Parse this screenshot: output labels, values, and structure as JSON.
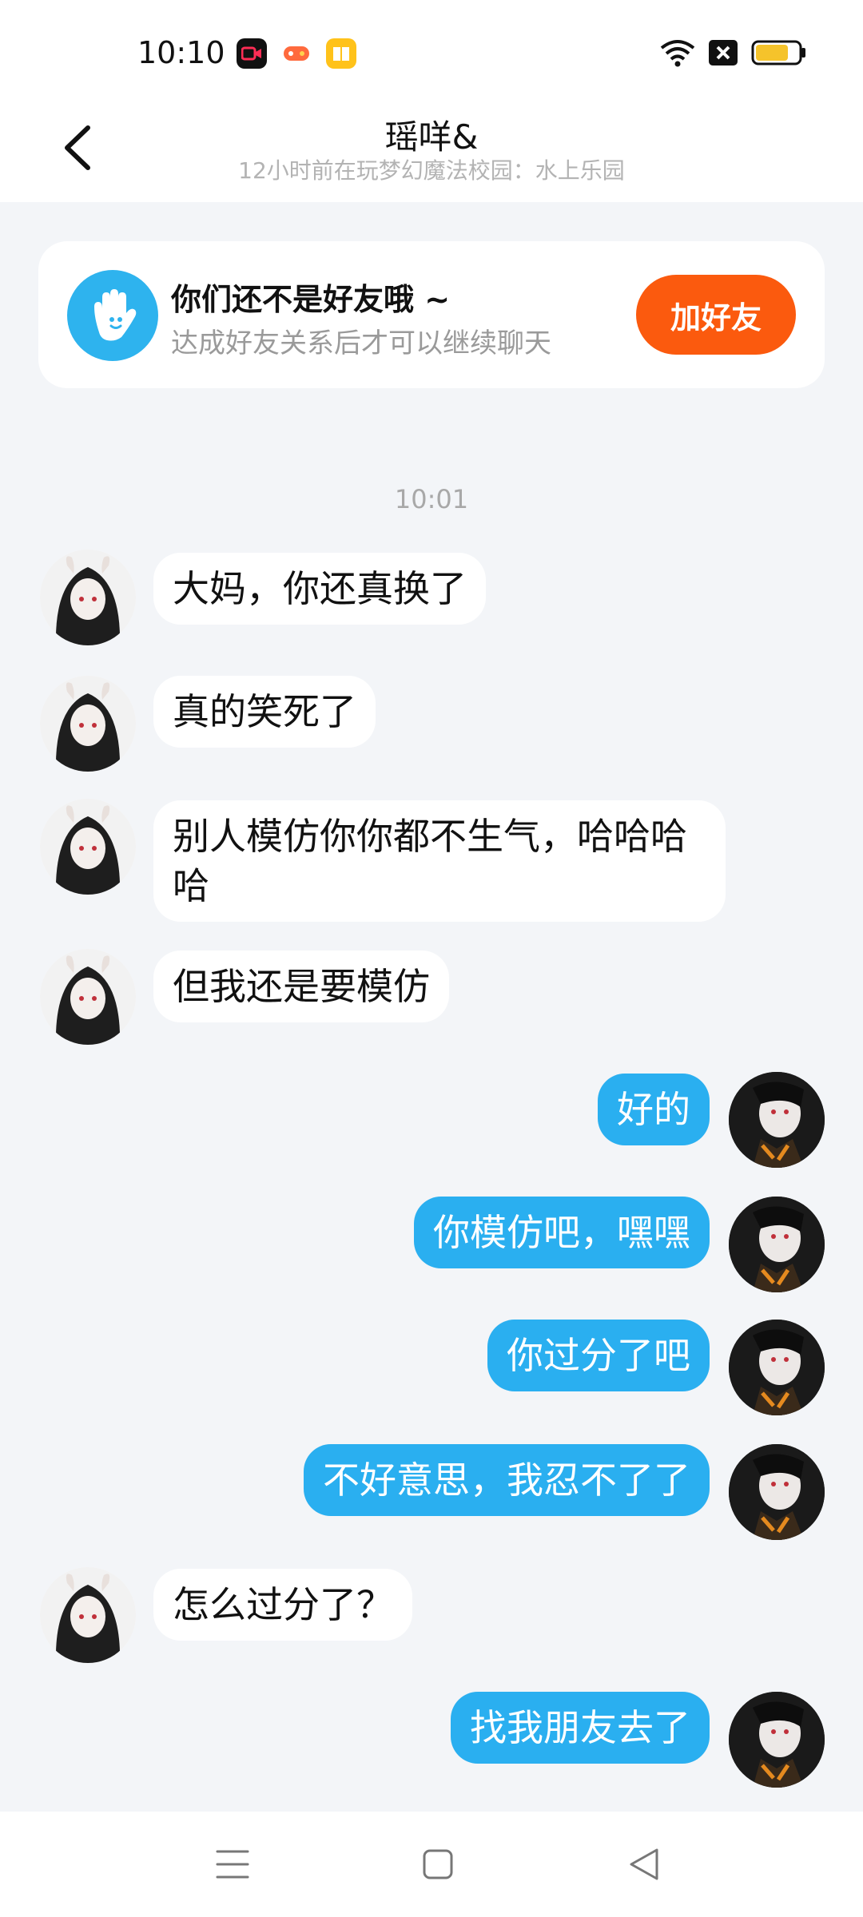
{
  "status": {
    "time": "10:10"
  },
  "header": {
    "title": "瑶咩&",
    "subtitle": "12小时前在玩梦幻魔法校园：水上乐园"
  },
  "banner": {
    "title": "你们还不是好友哦 ~",
    "subtitle": "达成好友关系后才可以继续聊天",
    "button": "加好友"
  },
  "chat": {
    "timestamp": "10:01",
    "messages": [
      {
        "side": "left",
        "text": "大妈，你还真换了"
      },
      {
        "side": "left",
        "text": "真的笑死了"
      },
      {
        "side": "left",
        "text": "别人模仿你你都不生气，哈哈哈哈"
      },
      {
        "side": "left",
        "text": "但我还是要模仿"
      },
      {
        "side": "right",
        "text": "好的"
      },
      {
        "side": "right",
        "text": "你模仿吧，嘿嘿"
      },
      {
        "side": "right",
        "text": "你过分了吧"
      },
      {
        "side": "right",
        "text": "不好意思，我忍不了了"
      },
      {
        "side": "left",
        "text": "怎么过分了？"
      },
      {
        "side": "right",
        "text": "找我朋友去了"
      }
    ]
  },
  "colors": {
    "my_bubble": "#2aaff0",
    "add_friend_button": "#fb5a0e",
    "background": "#f3f5f8"
  }
}
